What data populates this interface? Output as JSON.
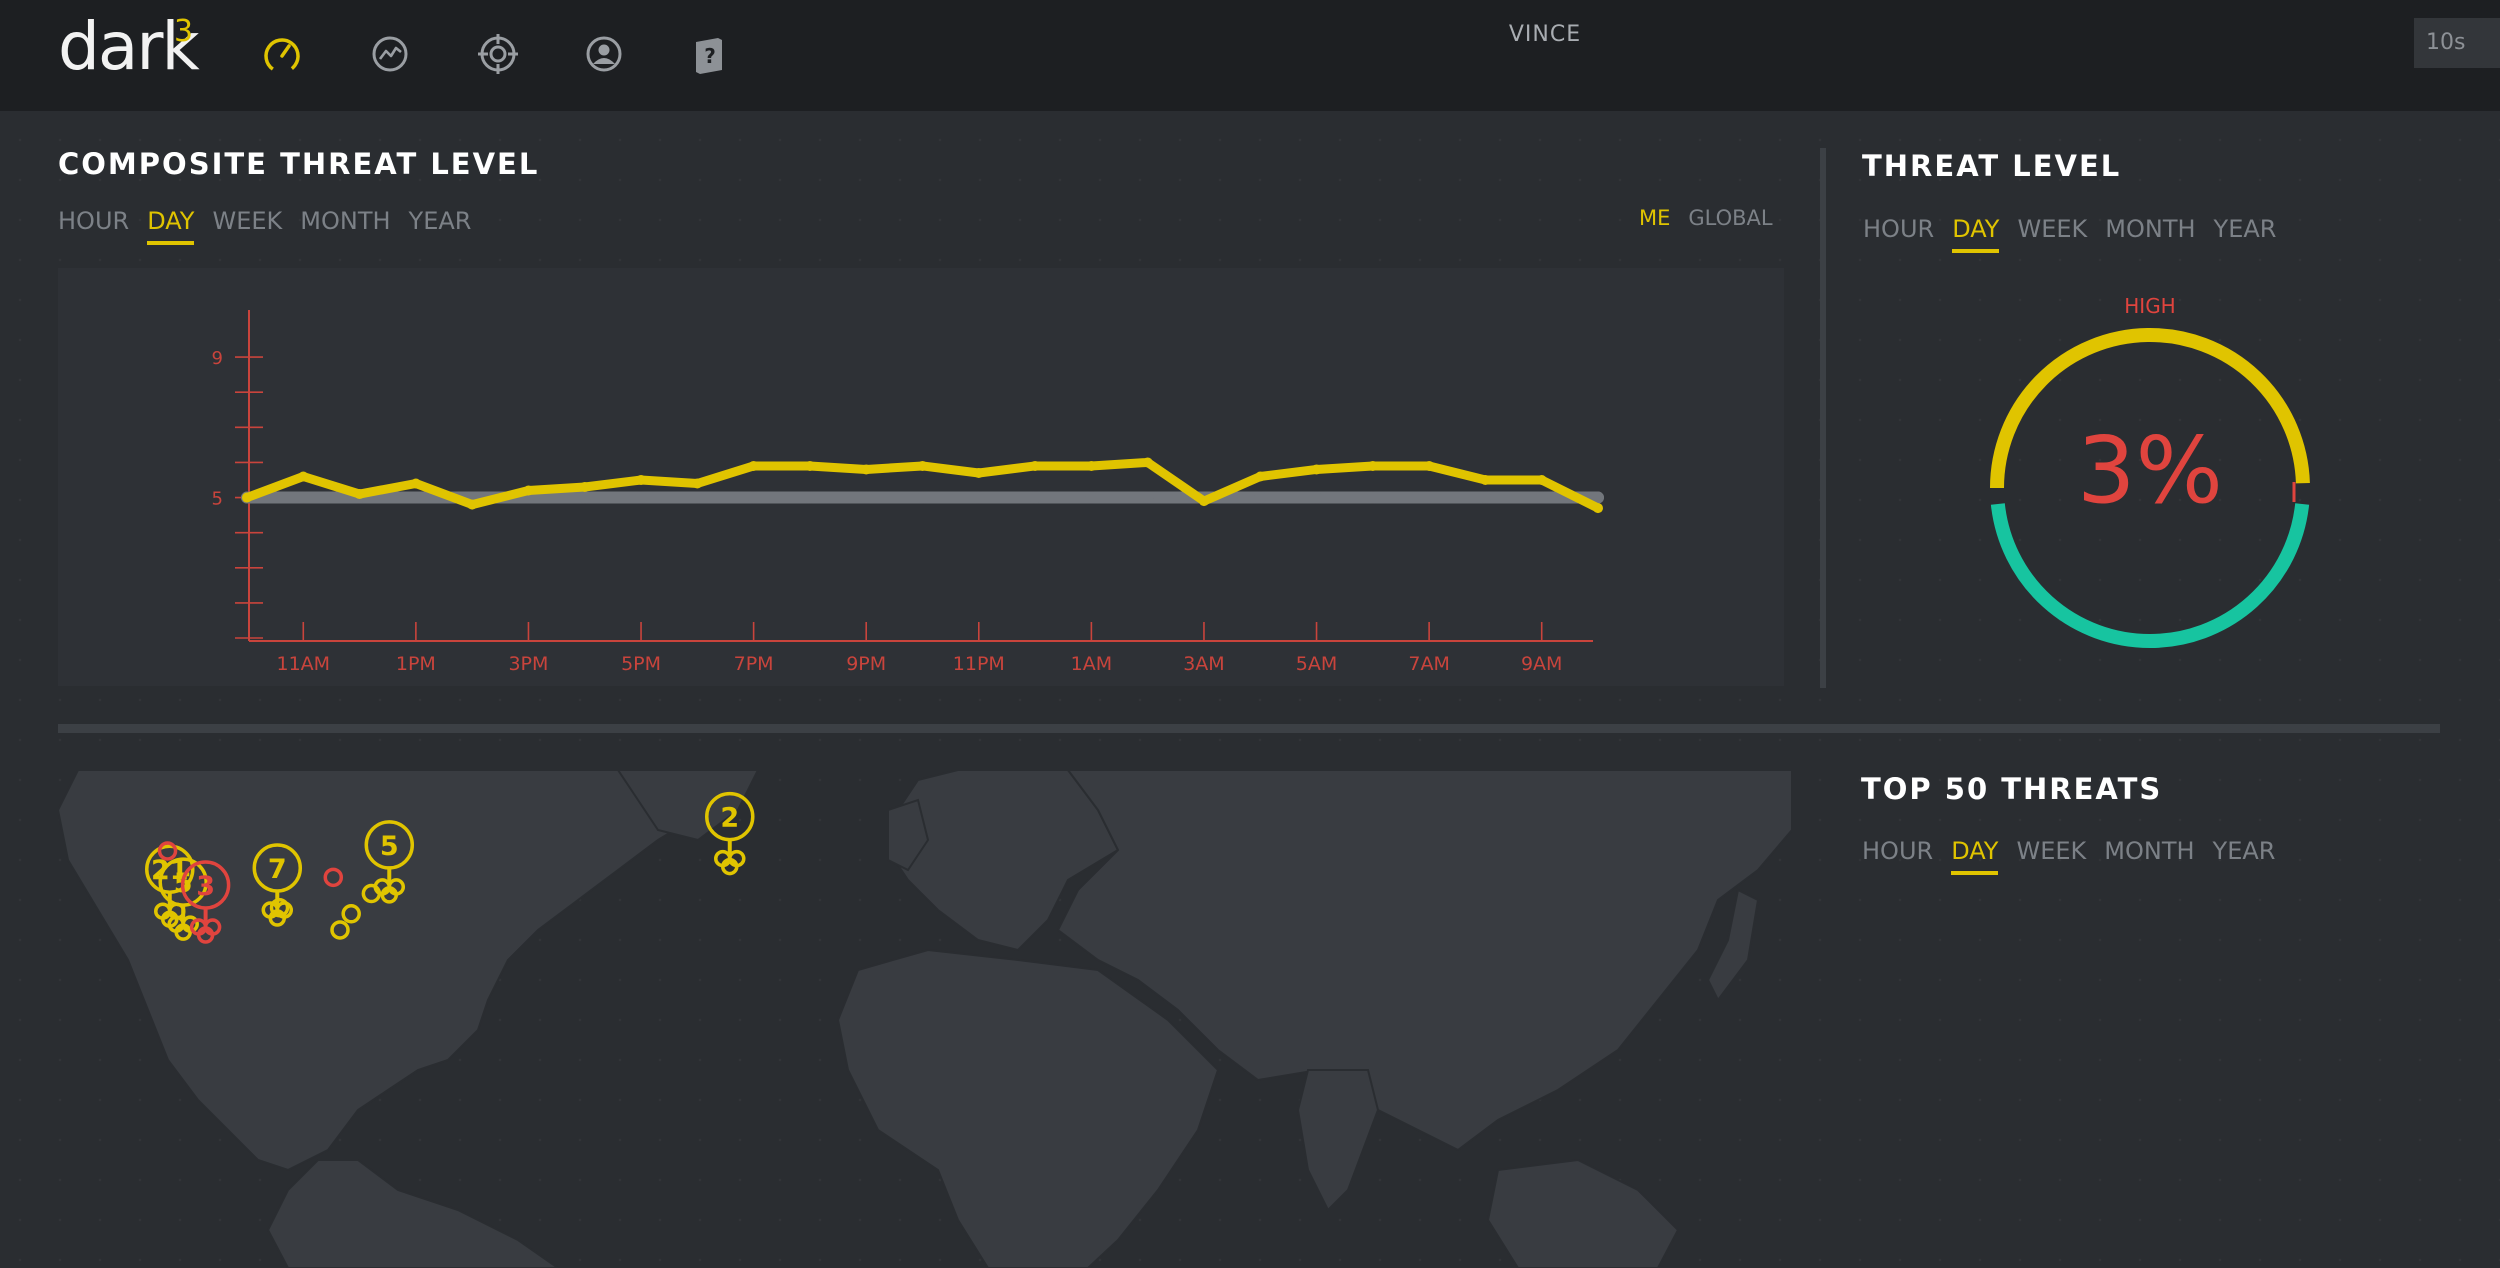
{
  "app": {
    "logo_text": "dark",
    "logo_superscript": "3",
    "username": "VINCE",
    "refresh_interval": "10s"
  },
  "nav": [
    {
      "name": "dashboard-gauge-icon",
      "active": true
    },
    {
      "name": "analytics-icon",
      "active": false
    },
    {
      "name": "target-icon",
      "active": false
    },
    {
      "name": "user-icon",
      "active": false
    },
    {
      "name": "help-book-icon",
      "active": false
    }
  ],
  "composite": {
    "title": "COMPOSITE THREAT LEVEL",
    "tabs": [
      "HOUR",
      "DAY",
      "WEEK",
      "MONTH",
      "YEAR"
    ],
    "active_tab": "DAY",
    "scope": [
      "ME",
      "GLOBAL"
    ],
    "active_scope": "ME"
  },
  "threat_level": {
    "title": "THREAT LEVEL",
    "tabs": [
      "HOUR",
      "DAY",
      "WEEK",
      "MONTH",
      "YEAR"
    ],
    "active_tab": "DAY",
    "level_label": "HIGH",
    "percent_label": "3%",
    "gauge_fraction": 0.5,
    "colors": {
      "high": "#e0c400",
      "low": "#17c4a0",
      "text": "#e0443e"
    }
  },
  "top_threats": {
    "title": "TOP 50 THREATS",
    "tabs": [
      "HOUR",
      "DAY",
      "WEEK",
      "MONTH",
      "YEAR"
    ],
    "active_tab": "DAY"
  },
  "chart_data": {
    "type": "line",
    "y_tick_labels": [
      "9",
      "5"
    ],
    "ylim": [
      1,
      10
    ],
    "x_tick_labels": [
      "11AM",
      "1PM",
      "3PM",
      "5PM",
      "7PM",
      "9PM",
      "11PM",
      "1AM",
      "3AM",
      "5AM",
      "7AM",
      "9AM"
    ],
    "series": [
      {
        "color": "#e0c400",
        "values": [
          5.0,
          5.6,
          5.1,
          5.4,
          4.8,
          5.2,
          5.3,
          5.5,
          5.4,
          5.9,
          5.9,
          5.8,
          5.9,
          5.7,
          5.9,
          5.9,
          6.0,
          4.9,
          5.6,
          5.8,
          5.9,
          5.9,
          5.5,
          5.5,
          4.7
        ]
      },
      {
        "color": "#72767c",
        "values": [
          5,
          5,
          5,
          5,
          5,
          5,
          5,
          5,
          5,
          5,
          5,
          5,
          5,
          5,
          5,
          5,
          5,
          5,
          5,
          5,
          5,
          5,
          5,
          5,
          5
        ]
      }
    ],
    "axis_color": "#c9443c"
  },
  "map": {
    "markers": [
      {
        "type": "cluster",
        "label": "2",
        "color": "#e0c400",
        "lon": 4.5,
        "lat": 50.5
      },
      {
        "type": "cluster",
        "label": "5",
        "color": "#e0c400",
        "lon": -71.5,
        "lat": 43.5
      },
      {
        "type": "cluster",
        "label": "7",
        "color": "#e0c400",
        "lon": -96.5,
        "lat": 37.8
      },
      {
        "type": "cluster",
        "label": "21",
        "color": "#e0c400",
        "lon": -120.5,
        "lat": 37.5
      },
      {
        "type": "cluster",
        "label": "5",
        "color": "#e0c400",
        "lon": -117.5,
        "lat": 34.3
      },
      {
        "type": "cluster",
        "label": "3",
        "color": "#e0443e",
        "lon": -112.5,
        "lat": 33.6
      },
      {
        "type": "point",
        "color": "#e0443e",
        "lon": -84.0,
        "lat": 35.5
      },
      {
        "type": "point",
        "color": "#e0443e",
        "lon": -121.0,
        "lat": 42.0
      },
      {
        "type": "point",
        "color": "#e0c400",
        "lon": -75.5,
        "lat": 31.5
      },
      {
        "type": "point",
        "color": "#e0c400",
        "lon": -80.0,
        "lat": 26.5
      },
      {
        "type": "point",
        "color": "#e0c400",
        "lon": -96.0,
        "lat": 28.0
      },
      {
        "type": "point",
        "color": "#e0c400",
        "lon": -82.5,
        "lat": 22.5
      }
    ]
  }
}
